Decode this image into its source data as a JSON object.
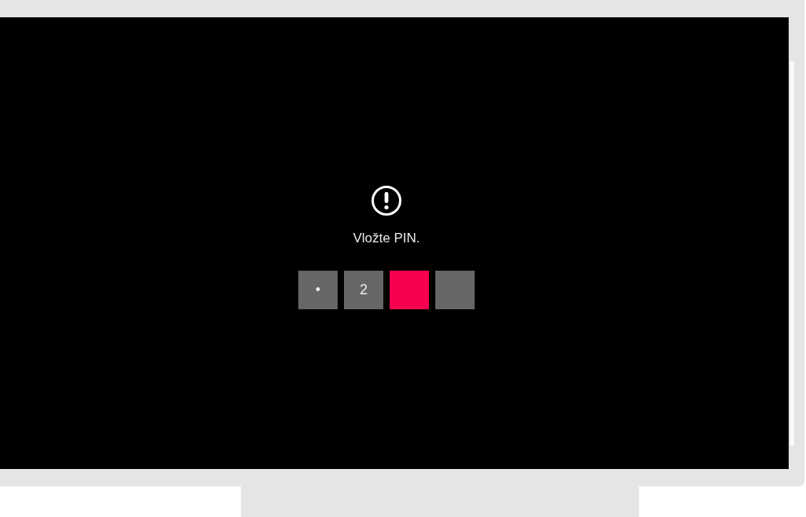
{
  "screen": {
    "message": "Vložte PIN.",
    "pin_boxes": [
      {
        "text": "•",
        "selected": false
      },
      {
        "text": "2",
        "selected": false
      },
      {
        "selected": true
      },
      {
        "selected": false
      }
    ]
  }
}
